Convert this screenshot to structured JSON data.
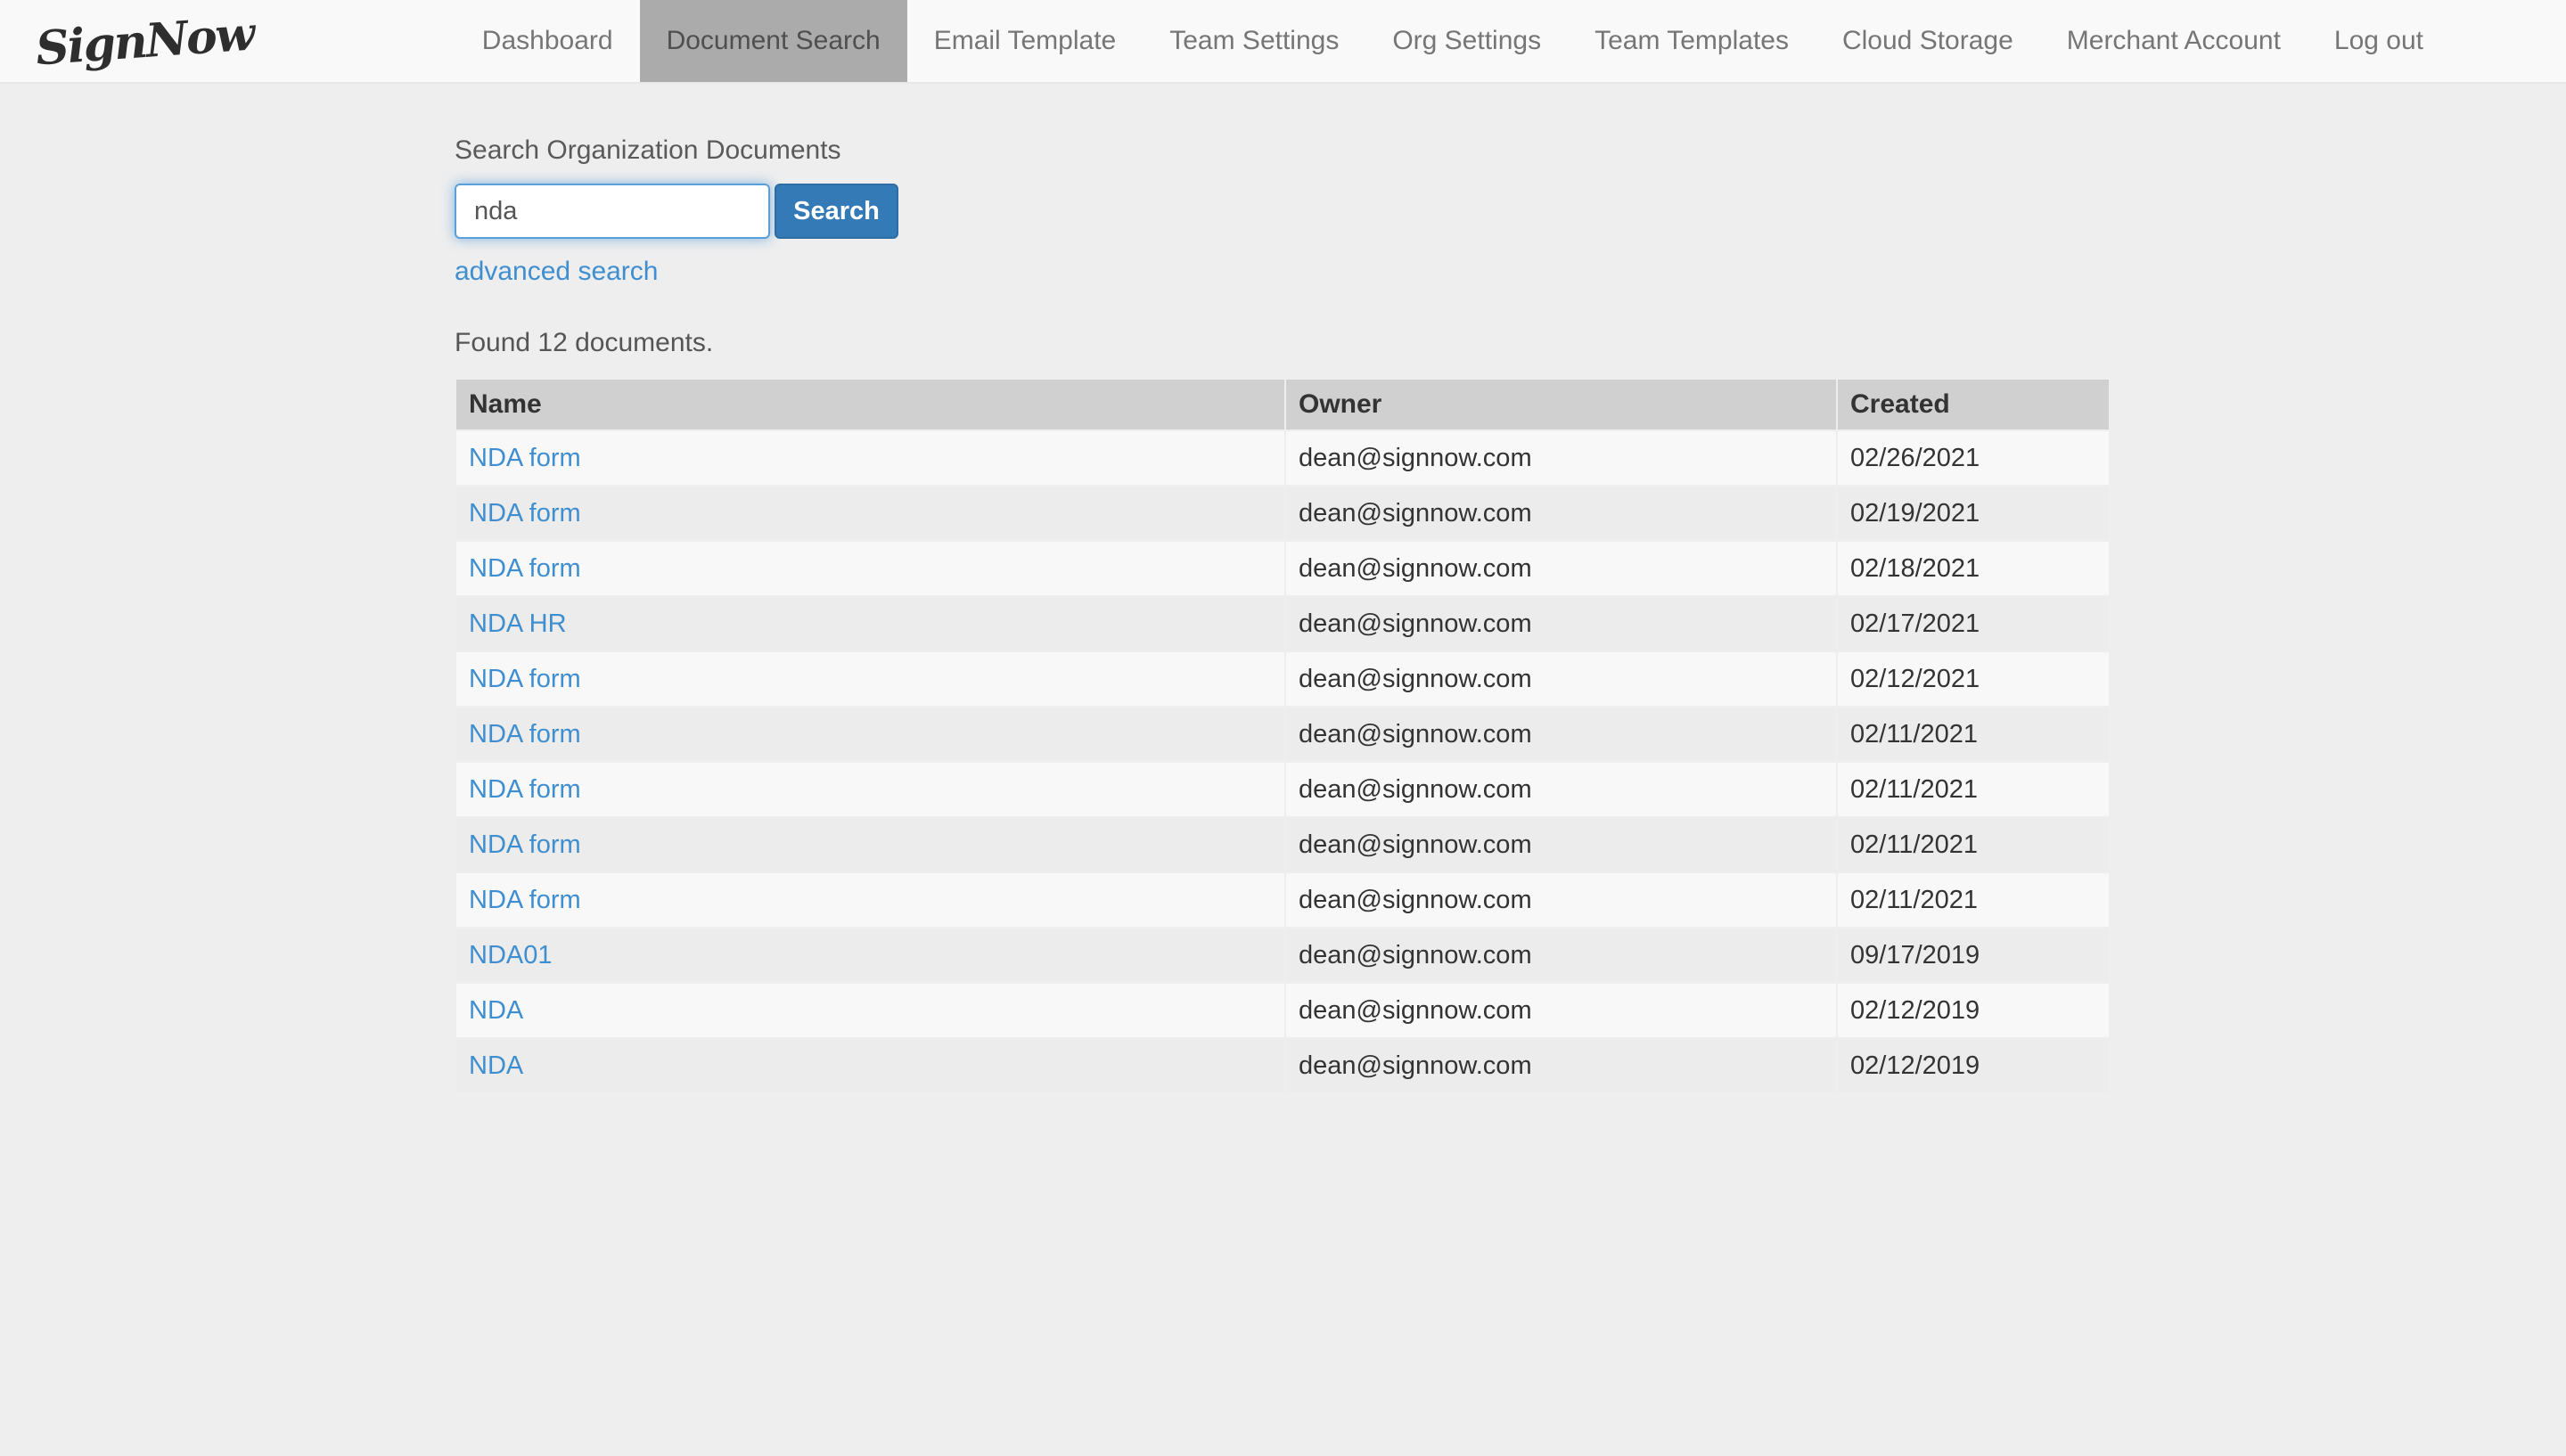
{
  "nav": {
    "logo": "SignNow",
    "items": [
      {
        "label": "Dashboard",
        "active": false
      },
      {
        "label": "Document Search",
        "active": true
      },
      {
        "label": "Email Template",
        "active": false
      },
      {
        "label": "Team Settings",
        "active": false
      },
      {
        "label": "Org Settings",
        "active": false
      },
      {
        "label": "Team Templates",
        "active": false
      },
      {
        "label": "Cloud Storage",
        "active": false
      },
      {
        "label": "Merchant Account",
        "active": false
      },
      {
        "label": "Log out",
        "active": false
      }
    ]
  },
  "search": {
    "label": "Search Organization Documents",
    "input_value": "nda",
    "button_label": "Search",
    "advanced_search_label": "advanced search"
  },
  "results": {
    "summary": "Found 12 documents.",
    "columns": [
      "Name",
      "Owner",
      "Created"
    ],
    "rows": [
      {
        "name": "NDA form",
        "owner": "dean@signnow.com",
        "created": "02/26/2021"
      },
      {
        "name": "NDA form",
        "owner": "dean@signnow.com",
        "created": "02/19/2021"
      },
      {
        "name": "NDA form",
        "owner": "dean@signnow.com",
        "created": "02/18/2021"
      },
      {
        "name": "NDA HR",
        "owner": "dean@signnow.com",
        "created": "02/17/2021"
      },
      {
        "name": "NDA form",
        "owner": "dean@signnow.com",
        "created": "02/12/2021"
      },
      {
        "name": "NDA form",
        "owner": "dean@signnow.com",
        "created": "02/11/2021"
      },
      {
        "name": "NDA form",
        "owner": "dean@signnow.com",
        "created": "02/11/2021"
      },
      {
        "name": "NDA form",
        "owner": "dean@signnow.com",
        "created": "02/11/2021"
      },
      {
        "name": "NDA form",
        "owner": "dean@signnow.com",
        "created": "02/11/2021"
      },
      {
        "name": "NDA01",
        "owner": "dean@signnow.com",
        "created": "09/17/2019"
      },
      {
        "name": "NDA",
        "owner": "dean@signnow.com",
        "created": "02/12/2019"
      },
      {
        "name": "NDA",
        "owner": "dean@signnow.com",
        "created": "02/12/2019"
      }
    ]
  },
  "colors": {
    "page_bg": "#eeeeee",
    "navbar_bg": "#f9f9f9",
    "nav_active_bg": "#ababab",
    "link_blue": "#3f8ed0",
    "button_bg": "#337ab7",
    "button_border": "#2e6da4",
    "input_focus_border": "#5aa0d8",
    "header_bg": "#d0d0d0",
    "row_light": "#f8f8f8",
    "row_dark": "#ececec"
  }
}
